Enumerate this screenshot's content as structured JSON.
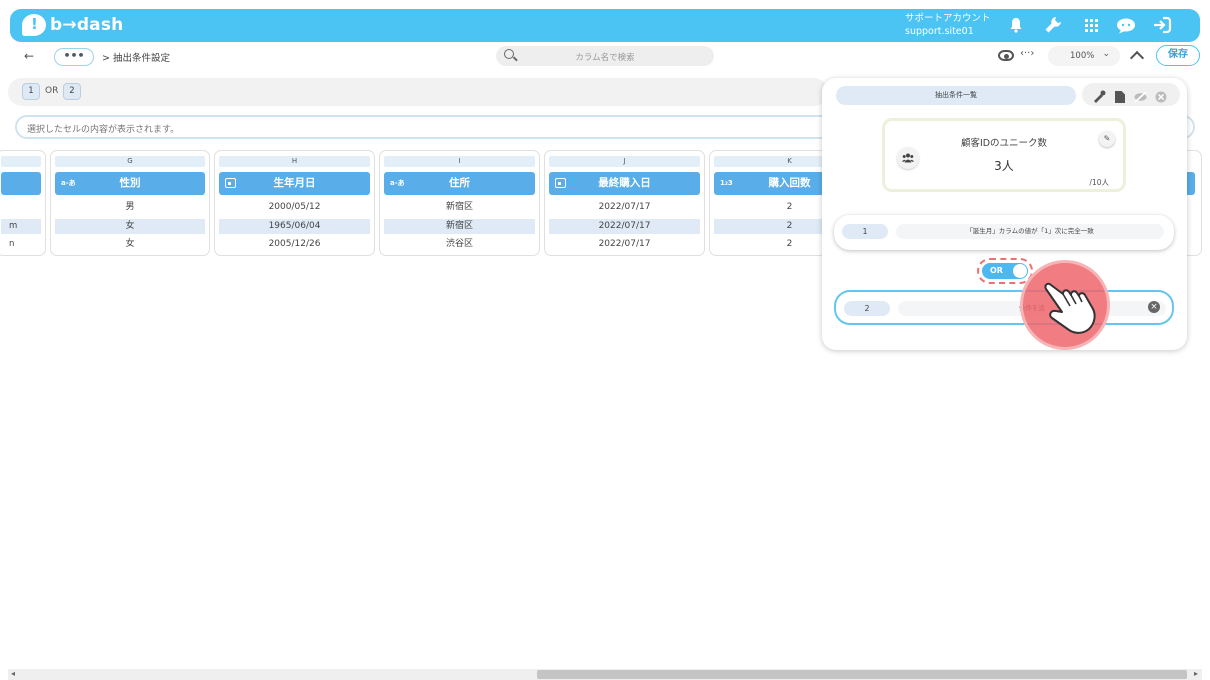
{
  "app": {
    "brand": "b→dash"
  },
  "header": {
    "account_label": "サポートアカウント",
    "account_id": "support.site01",
    "icons": [
      "bell-icon",
      "wrench-icon",
      "grid-icon",
      "chat-icon",
      "logout-icon"
    ]
  },
  "toolbar": {
    "back": "←",
    "more": "•••",
    "breadcrumb": "> 抽出条件設定",
    "search_placeholder": "カラム名で検索",
    "code_toggle": "‹··›",
    "zoom": "100%",
    "save": "保存"
  },
  "strip": {
    "chip1": "1",
    "op": "OR",
    "chip2": "2"
  },
  "cell_bar": {
    "placeholder": "選択したセルの内容が表示されます。"
  },
  "table": {
    "columns": [
      {
        "letter": "G",
        "name": "性別",
        "type": "a-あ",
        "cells": [
          "男",
          "女",
          "女"
        ]
      },
      {
        "letter": "H",
        "name": "生年月日",
        "type": "calendar",
        "cells": [
          "2000/05/12",
          "1965/06/04",
          "2005/12/26"
        ]
      },
      {
        "letter": "I",
        "name": "住所",
        "type": "a-あ",
        "cells": [
          "新宿区",
          "新宿区",
          "渋谷区"
        ]
      },
      {
        "letter": "J",
        "name": "最終購入日",
        "type": "calendar",
        "cells": [
          "2022/07/17",
          "2022/07/17",
          "2022/07/17"
        ]
      },
      {
        "letter": "K",
        "name": "購入回数",
        "type": "1₂3",
        "cells": [
          "2",
          "2",
          "2"
        ]
      }
    ],
    "left_edge_cells": [
      "m",
      "n"
    ]
  },
  "panel": {
    "title": "抽出条件一覧",
    "summary": {
      "title": "顧客IDのユニーク数",
      "value": "3人",
      "total": "/10人"
    },
    "conditions": [
      {
        "num": "1",
        "text": "「誕生月」カラムの値が「1」次に完全一致"
      },
      {
        "num": "2",
        "text": "条件を追"
      }
    ],
    "toggle_label": "OR"
  },
  "colors": {
    "brand": "#4bc3f3",
    "column_header": "#59aee9",
    "highlight": "#ef6f75"
  }
}
